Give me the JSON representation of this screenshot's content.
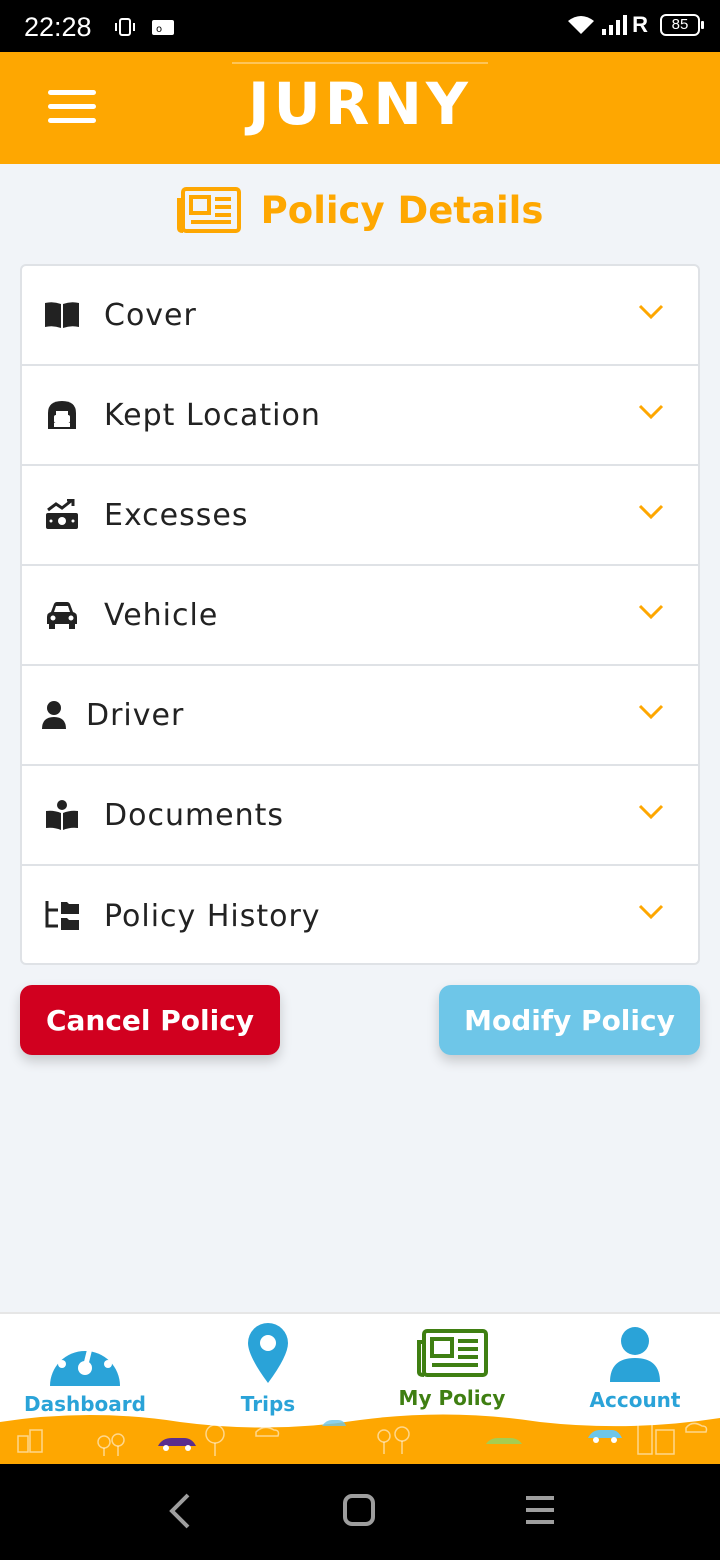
{
  "status_bar": {
    "time": "22:28",
    "network_letter": "R",
    "battery": "85"
  },
  "header": {
    "logo": "JURNY",
    "brand_color": "#fea701"
  },
  "page": {
    "title": "Policy Details"
  },
  "sections": [
    {
      "label": "Cover",
      "icon": "book-open-icon"
    },
    {
      "label": "Kept Location",
      "icon": "garage-icon"
    },
    {
      "label": "Excesses",
      "icon": "money-chart-icon"
    },
    {
      "label": "Vehicle",
      "icon": "car-icon"
    },
    {
      "label": "Driver",
      "icon": "user-icon"
    },
    {
      "label": "Documents",
      "icon": "reader-icon"
    },
    {
      "label": "Policy History",
      "icon": "folder-tree-icon"
    }
  ],
  "actions": {
    "cancel_label": "Cancel Policy",
    "modify_label": "Modify Policy",
    "cancel_color": "#d1001f",
    "modify_color": "#6ec6e8"
  },
  "bottom_nav": {
    "items": [
      {
        "label": "Dashboard",
        "icon": "speedometer-icon",
        "color": "#2aa3d8"
      },
      {
        "label": "Trips",
        "icon": "map-pin-icon",
        "color": "#2aa3d8"
      },
      {
        "label": "My Policy",
        "icon": "newspaper-icon",
        "color": "#3f7f12",
        "active": true
      },
      {
        "label": "Account",
        "icon": "account-icon",
        "color": "#2aa3d8"
      }
    ]
  }
}
